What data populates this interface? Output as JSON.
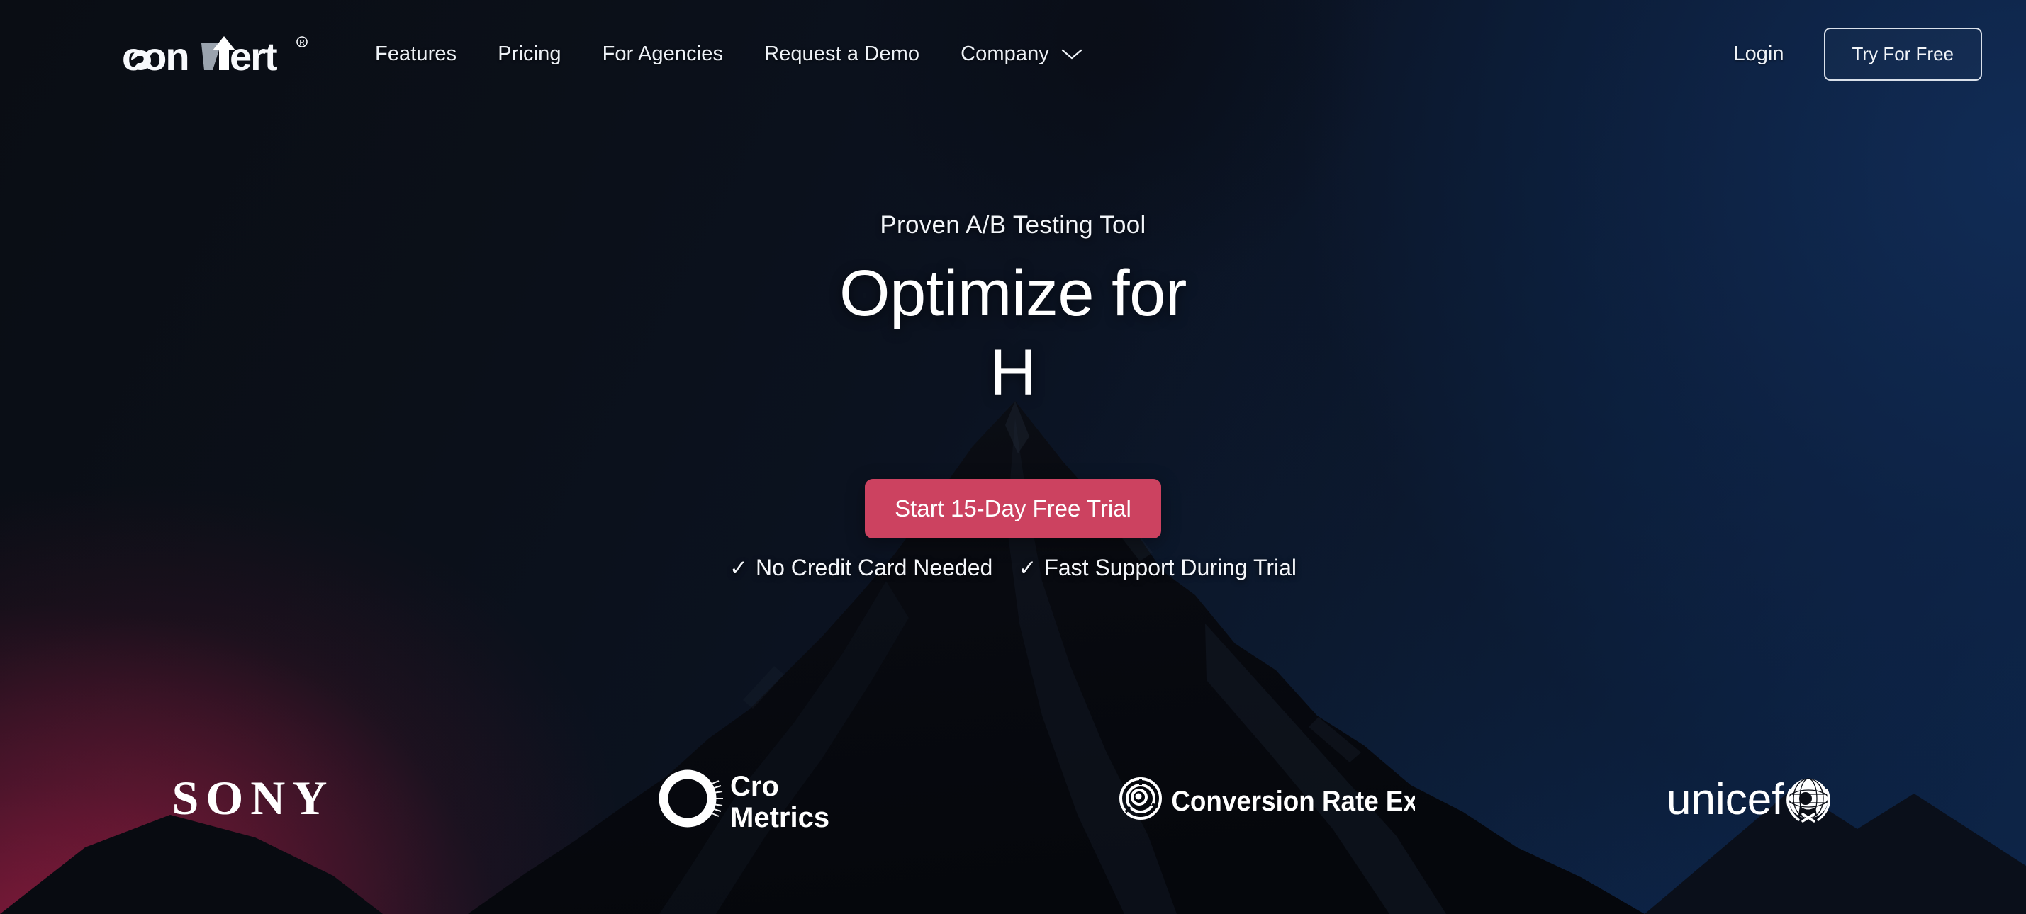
{
  "brand": {
    "logo_text": "convert",
    "logo_mark": "convert-arrow-logo",
    "registered_mark": "®"
  },
  "nav": {
    "items": [
      {
        "label": "Features",
        "has_dropdown": false
      },
      {
        "label": "Pricing",
        "has_dropdown": false
      },
      {
        "label": "For Agencies",
        "has_dropdown": false
      },
      {
        "label": "Request a Demo",
        "has_dropdown": false
      },
      {
        "label": "Company",
        "has_dropdown": true,
        "icon": "chevron-down-icon"
      }
    ],
    "login_label": "Login",
    "try_label": "Try For Free"
  },
  "hero": {
    "eyebrow": "Proven A/B Testing Tool",
    "headline_line1": "Optimize for",
    "headline_line2": "H",
    "cta_label": "Start 15-Day Free Trial",
    "assurances": [
      {
        "tick": "✓",
        "label": "No Credit Card Needed"
      },
      {
        "tick": "✓",
        "label": "Fast Support During Trial"
      }
    ]
  },
  "clients": [
    {
      "name": "SONY",
      "icon": "sony-logo"
    },
    {
      "name": "Cro Metrics",
      "line1": "Cro",
      "line2": "Metrics",
      "icon": "crometrics-logo"
    },
    {
      "name": "Conversion Rate Experts",
      "icon": "conversion-rate-experts-logo"
    },
    {
      "name": "unicef",
      "icon": "unicef-logo"
    }
  ],
  "colors": {
    "cta_background": "#cc4260",
    "cta_text": "#ffffff",
    "text_primary": "#ffffff",
    "sky_navy": "#0d2447",
    "sky_crimson": "#a81e46",
    "sky_dark": "#0a0d14"
  }
}
